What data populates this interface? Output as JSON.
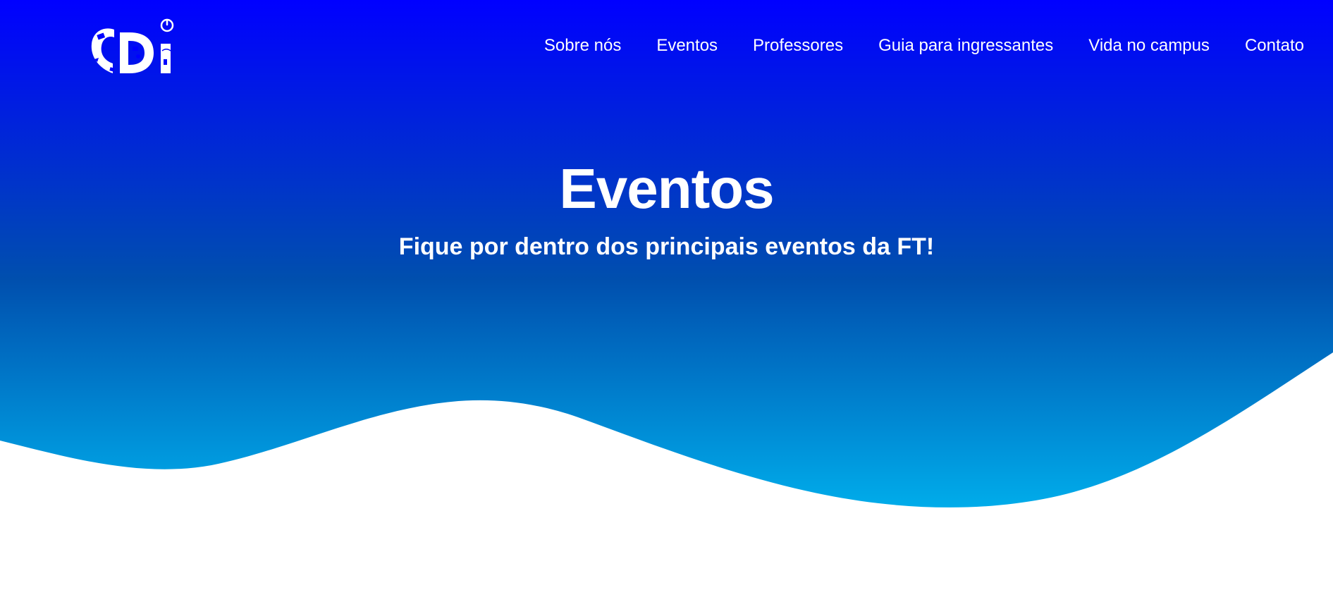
{
  "brand": {
    "logo_text": "CDI",
    "logo_color": "#ffffff"
  },
  "nav": {
    "items": [
      {
        "label": "Sobre nós"
      },
      {
        "label": "Eventos"
      },
      {
        "label": "Professores"
      },
      {
        "label": "Guia para ingressantes"
      },
      {
        "label": "Vida no campus"
      },
      {
        "label": "Contato"
      }
    ]
  },
  "hero": {
    "title": "Eventos",
    "subtitle": "Fique por dentro dos principais eventos da FT!",
    "gradient_top": "#0000ff",
    "gradient_mid": "#004fae",
    "gradient_bottom": "#00acea",
    "text_color": "#ffffff"
  },
  "page": {
    "background": "#ffffff"
  }
}
